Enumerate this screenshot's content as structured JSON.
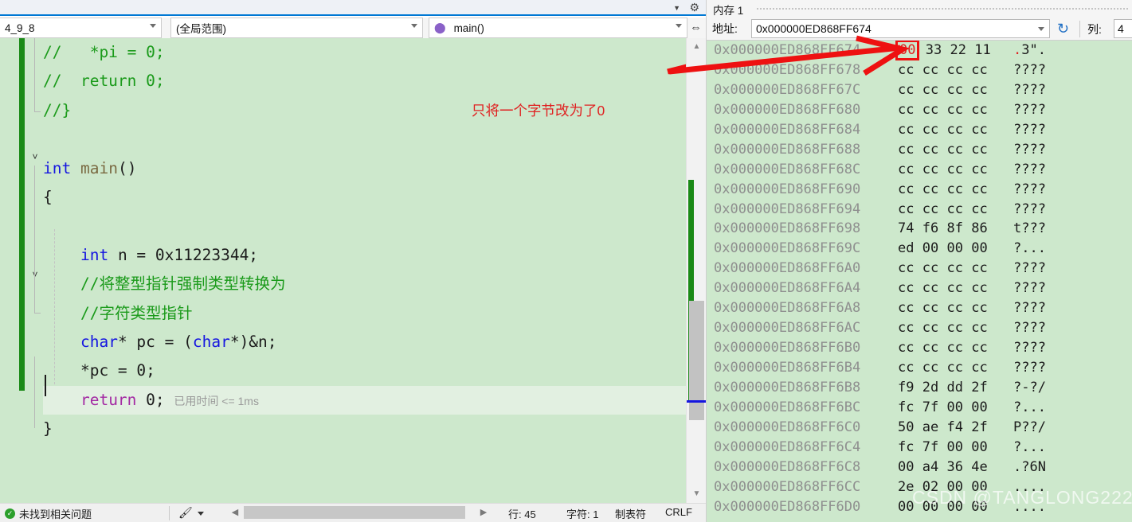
{
  "editor": {
    "navbar": {
      "file_selector": "4_9_8",
      "scope_selector": "(全局范围)",
      "function_selector": "main()",
      "function_icon": "cube-icon",
      "split_icon": "split-window-icon"
    },
    "top_strip": {
      "chevron_icon": "chevron-down-icon",
      "gear_icon": "gear-icon"
    },
    "code_lines": [
      {
        "tokens": [
          {
            "t": "//   *pi = 0;",
            "c": "cmt"
          }
        ]
      },
      {
        "tokens": [
          {
            "t": "//  return 0;",
            "c": "cmt"
          }
        ]
      },
      {
        "tokens": [
          {
            "t": "//}",
            "c": "cmt"
          }
        ]
      },
      {
        "tokens": [
          {
            "t": "",
            "c": "pln"
          }
        ]
      },
      {
        "tokens": [
          {
            "t": "int",
            "c": "kw"
          },
          {
            "t": " ",
            "c": "pln"
          },
          {
            "t": "main",
            "c": "fn"
          },
          {
            "t": "()",
            "c": "pln"
          }
        ]
      },
      {
        "tokens": [
          {
            "t": "{",
            "c": "pln"
          }
        ]
      },
      {
        "tokens": [
          {
            "t": "",
            "c": "pln"
          }
        ]
      },
      {
        "tokens": [
          {
            "t": "    ",
            "c": "pln"
          },
          {
            "t": "int",
            "c": "kw"
          },
          {
            "t": " n = 0x11223344;",
            "c": "pln"
          }
        ]
      },
      {
        "tokens": [
          {
            "t": "    //将整型指针强制类型转换为",
            "c": "cmt"
          }
        ]
      },
      {
        "tokens": [
          {
            "t": "    //字符类型指针",
            "c": "cmt"
          }
        ]
      },
      {
        "tokens": [
          {
            "t": "    ",
            "c": "pln"
          },
          {
            "t": "char",
            "c": "kw"
          },
          {
            "t": "* pc = (",
            "c": "pln"
          },
          {
            "t": "char",
            "c": "kw"
          },
          {
            "t": "*)&n;",
            "c": "pln"
          }
        ]
      },
      {
        "tokens": [
          {
            "t": "    *pc = 0;",
            "c": "pln"
          }
        ]
      },
      {
        "highlight": true,
        "tokens": [
          {
            "t": "    ",
            "c": "pln"
          },
          {
            "t": "return",
            "c": "ret"
          },
          {
            "t": " 0; ",
            "c": "pln"
          },
          {
            "t": "已用时间 <= 1ms",
            "c": "hint"
          }
        ]
      },
      {
        "tokens": [
          {
            "t": "}",
            "c": "pln"
          }
        ]
      }
    ],
    "annotation": {
      "text": "只将一个字节改为了0",
      "color": "#e02020",
      "arrow_icon": "red-arrow-icon"
    },
    "scrollbar": {
      "up_icon": "scroll-up-arrow-icon",
      "down_icon": "scroll-down-arrow-icon",
      "thumb_icon": "scrollbar-thumb"
    },
    "statusbar": {
      "issues_icon": "status-ok-icon",
      "issues_text": "未找到相关问题",
      "brush_icon": "brush-icon",
      "brush_dropdown_icon": "chevron-down-icon",
      "hscroll_left_icon": "scroll-left-arrow-icon",
      "hscroll_right_icon": "scroll-right-arrow-icon",
      "line": "行: 45",
      "column": "字符: 1",
      "indent": "制表符",
      "eol": "CRLF"
    }
  },
  "memory": {
    "window_title": "内存 1",
    "address_label": "地址:",
    "address_value": "0x000000ED868FF674",
    "address_dropdown_icon": "chevron-down-icon",
    "refresh_icon": "refresh-icon",
    "columns_label": "列:",
    "columns_value": "4",
    "highlight_cell": {
      "row": 0,
      "index": 0,
      "value": "00",
      "color": "#e02020"
    },
    "rows": [
      {
        "addr": "0x000000ED868FF674",
        "bytes": [
          "00",
          "33",
          "22",
          "11"
        ],
        "ascii": ".3\".",
        "ascii_red_prefix": "."
      },
      {
        "addr": "0x000000ED868FF678",
        "bytes": [
          "cc",
          "cc",
          "cc",
          "cc"
        ],
        "ascii": "????"
      },
      {
        "addr": "0x000000ED868FF67C",
        "bytes": [
          "cc",
          "cc",
          "cc",
          "cc"
        ],
        "ascii": "????"
      },
      {
        "addr": "0x000000ED868FF680",
        "bytes": [
          "cc",
          "cc",
          "cc",
          "cc"
        ],
        "ascii": "????"
      },
      {
        "addr": "0x000000ED868FF684",
        "bytes": [
          "cc",
          "cc",
          "cc",
          "cc"
        ],
        "ascii": "????"
      },
      {
        "addr": "0x000000ED868FF688",
        "bytes": [
          "cc",
          "cc",
          "cc",
          "cc"
        ],
        "ascii": "????"
      },
      {
        "addr": "0x000000ED868FF68C",
        "bytes": [
          "cc",
          "cc",
          "cc",
          "cc"
        ],
        "ascii": "????"
      },
      {
        "addr": "0x000000ED868FF690",
        "bytes": [
          "cc",
          "cc",
          "cc",
          "cc"
        ],
        "ascii": "????"
      },
      {
        "addr": "0x000000ED868FF694",
        "bytes": [
          "cc",
          "cc",
          "cc",
          "cc"
        ],
        "ascii": "????"
      },
      {
        "addr": "0x000000ED868FF698",
        "bytes": [
          "74",
          "f6",
          "8f",
          "86"
        ],
        "ascii": "t???"
      },
      {
        "addr": "0x000000ED868FF69C",
        "bytes": [
          "ed",
          "00",
          "00",
          "00"
        ],
        "ascii": "?..."
      },
      {
        "addr": "0x000000ED868FF6A0",
        "bytes": [
          "cc",
          "cc",
          "cc",
          "cc"
        ],
        "ascii": "????"
      },
      {
        "addr": "0x000000ED868FF6A4",
        "bytes": [
          "cc",
          "cc",
          "cc",
          "cc"
        ],
        "ascii": "????"
      },
      {
        "addr": "0x000000ED868FF6A8",
        "bytes": [
          "cc",
          "cc",
          "cc",
          "cc"
        ],
        "ascii": "????"
      },
      {
        "addr": "0x000000ED868FF6AC",
        "bytes": [
          "cc",
          "cc",
          "cc",
          "cc"
        ],
        "ascii": "????"
      },
      {
        "addr": "0x000000ED868FF6B0",
        "bytes": [
          "cc",
          "cc",
          "cc",
          "cc"
        ],
        "ascii": "????"
      },
      {
        "addr": "0x000000ED868FF6B4",
        "bytes": [
          "cc",
          "cc",
          "cc",
          "cc"
        ],
        "ascii": "????"
      },
      {
        "addr": "0x000000ED868FF6B8",
        "bytes": [
          "f9",
          "2d",
          "dd",
          "2f"
        ],
        "ascii": "?-?/"
      },
      {
        "addr": "0x000000ED868FF6BC",
        "bytes": [
          "fc",
          "7f",
          "00",
          "00"
        ],
        "ascii": "?..."
      },
      {
        "addr": "0x000000ED868FF6C0",
        "bytes": [
          "50",
          "ae",
          "f4",
          "2f"
        ],
        "ascii": "P??/"
      },
      {
        "addr": "0x000000ED868FF6C4",
        "bytes": [
          "fc",
          "7f",
          "00",
          "00"
        ],
        "ascii": "?..."
      },
      {
        "addr": "0x000000ED868FF6C8",
        "bytes": [
          "00",
          "a4",
          "36",
          "4e"
        ],
        "ascii": ".?6N"
      },
      {
        "addr": "0x000000ED868FF6CC",
        "bytes": [
          "2e",
          "02",
          "00",
          "00"
        ],
        "ascii": "...."
      },
      {
        "addr": "0x000000ED868FF6D0",
        "bytes": [
          "00",
          "00",
          "00",
          "00"
        ],
        "ascii": "...."
      }
    ]
  },
  "watermark": {
    "text": "CSDN @TANGLONG222"
  },
  "colors": {
    "editor_background": "#cde8cc",
    "memory_background": "#cde8cc",
    "accent": "#0078d4",
    "annotation_red": "#e02020",
    "change_bar_green": "#1a8a17"
  }
}
